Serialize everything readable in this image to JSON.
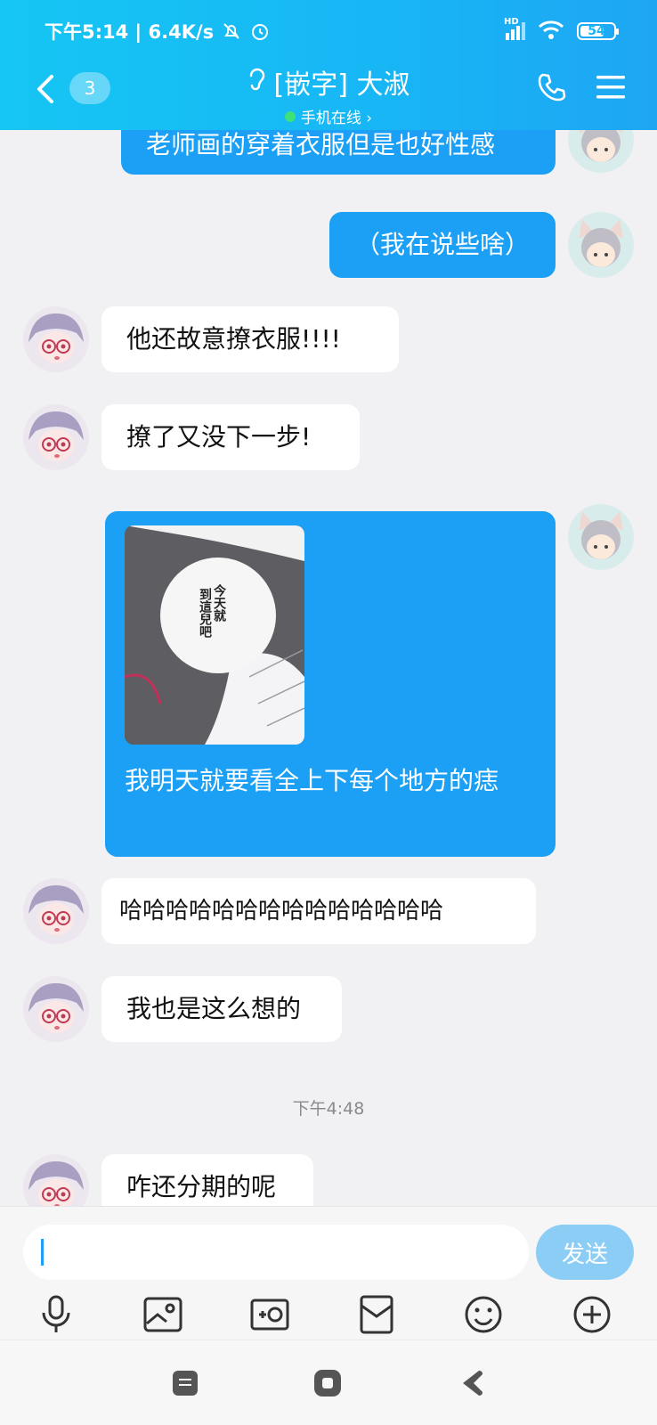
{
  "status_bar": {
    "time_speed": "下午5:14 | 6.4K/s",
    "network": "HD",
    "battery": "54"
  },
  "header": {
    "unread_badge": "3",
    "contact_name": "[嵌字] 大淑",
    "online_status": "手机在线 ›"
  },
  "messages": {
    "m1": "老师画的穿着衣服但是也好性感",
    "m2": "（我在说些啥）",
    "m3": "他还故意撩衣服!!!!",
    "m4": "撩了又没下一步!",
    "m5_image_text_a": "今天就",
    "m5_image_text_b": "到這兒吧",
    "m5_caption": "我明天就要看全上下每个地方的痣",
    "m6": "哈哈哈哈哈哈哈哈哈哈哈哈哈哈",
    "m7": "我也是这么想的",
    "timestamp": "下午4:48",
    "m8": "咋还分期的呢"
  },
  "input": {
    "placeholder": "",
    "send_label": "发送"
  },
  "colors": {
    "header_gradient_start": "#16c6f4",
    "header_gradient_end": "#1ea6f3",
    "my_bubble": "#1ba0f5",
    "their_bubble": "#ffffff",
    "send_button": "#8ccdf6"
  }
}
